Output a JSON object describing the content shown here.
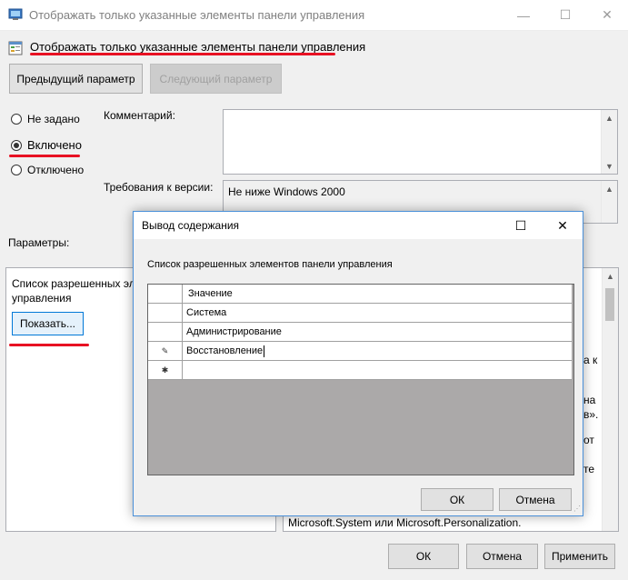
{
  "window": {
    "title": "Отображать только указанные элементы панели управления",
    "minimize": "—",
    "maximize": "☐",
    "close": "✕"
  },
  "setting_name": "Отображать только указанные элементы панели управления",
  "nav": {
    "prev": "Предыдущий параметр",
    "next": "Следующий параметр"
  },
  "radios": {
    "not_configured": "Не задано",
    "enabled": "Включено",
    "disabled": "Отключено"
  },
  "comment_label": "Комментарий:",
  "version_label": "Требования к версии:",
  "version_value": "Не ниже Windows 2000",
  "parameters_label": "Параметры:",
  "left_pane": {
    "label": "Список разрешенных эл",
    "label_line2": "управления",
    "show_button": "Показать..."
  },
  "help_fragments": [
    "а к",
    "на",
    "в».",
    "от",
    "те"
  ],
  "help_bottom": "Microsoft.System или Microsoft.Personalization.",
  "buttons": {
    "ok": "ОК",
    "cancel": "Отмена",
    "apply": "Применить"
  },
  "dialog": {
    "title": "Вывод содержания",
    "maximize": "☐",
    "close": "✕",
    "list_label": "Список разрешенных элементов панели управления",
    "column_header": "Значение",
    "rows": [
      "Система",
      "Администрирование",
      "Восстановление",
      ""
    ],
    "ok": "ОК",
    "cancel": "Отмена"
  }
}
